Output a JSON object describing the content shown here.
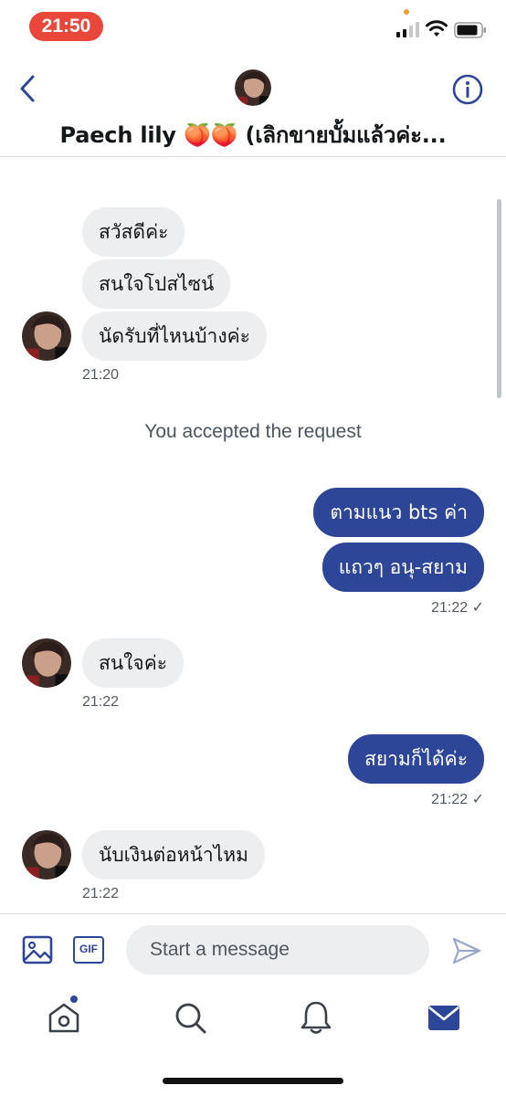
{
  "status_bar": {
    "time": "21:50"
  },
  "header": {
    "title": "Paech lily 🍑🍑 (เลิกขายบั้มแล้วค่ะ...",
    "back_icon": "chevron-left-icon",
    "info_icon": "info-circle-icon"
  },
  "messages": {
    "group1": {
      "bubbles": [
        "สวัสดีค่ะ",
        "สนใจโปสไซน์",
        "นัดรับที่ไหนบ้างค่ะ"
      ],
      "time": "21:20"
    },
    "system": "You accepted the request",
    "group2": {
      "bubbles": [
        "ตามแนว bts ค่า",
        "แถวๆ อนุ-สยาม"
      ],
      "time": "21:22 ✓"
    },
    "group3": {
      "bubbles": [
        "สนใจค่ะ"
      ],
      "time": "21:22"
    },
    "group4": {
      "bubbles": [
        "สยามก็ได้ค่ะ"
      ],
      "time": "21:22 ✓"
    },
    "group5": {
      "bubbles": [
        "นับเงินต่อหน้าไหม"
      ],
      "time": "21:22"
    }
  },
  "composer": {
    "gif_label": "GIF",
    "placeholder": "Start a message"
  },
  "tabbar": {
    "items": [
      "home-icon",
      "search-icon",
      "bell-icon",
      "mail-icon"
    ]
  },
  "colors": {
    "accent": "#2e4697",
    "incoming_bubble": "#eceef0",
    "status_pill": "#e8473a"
  }
}
